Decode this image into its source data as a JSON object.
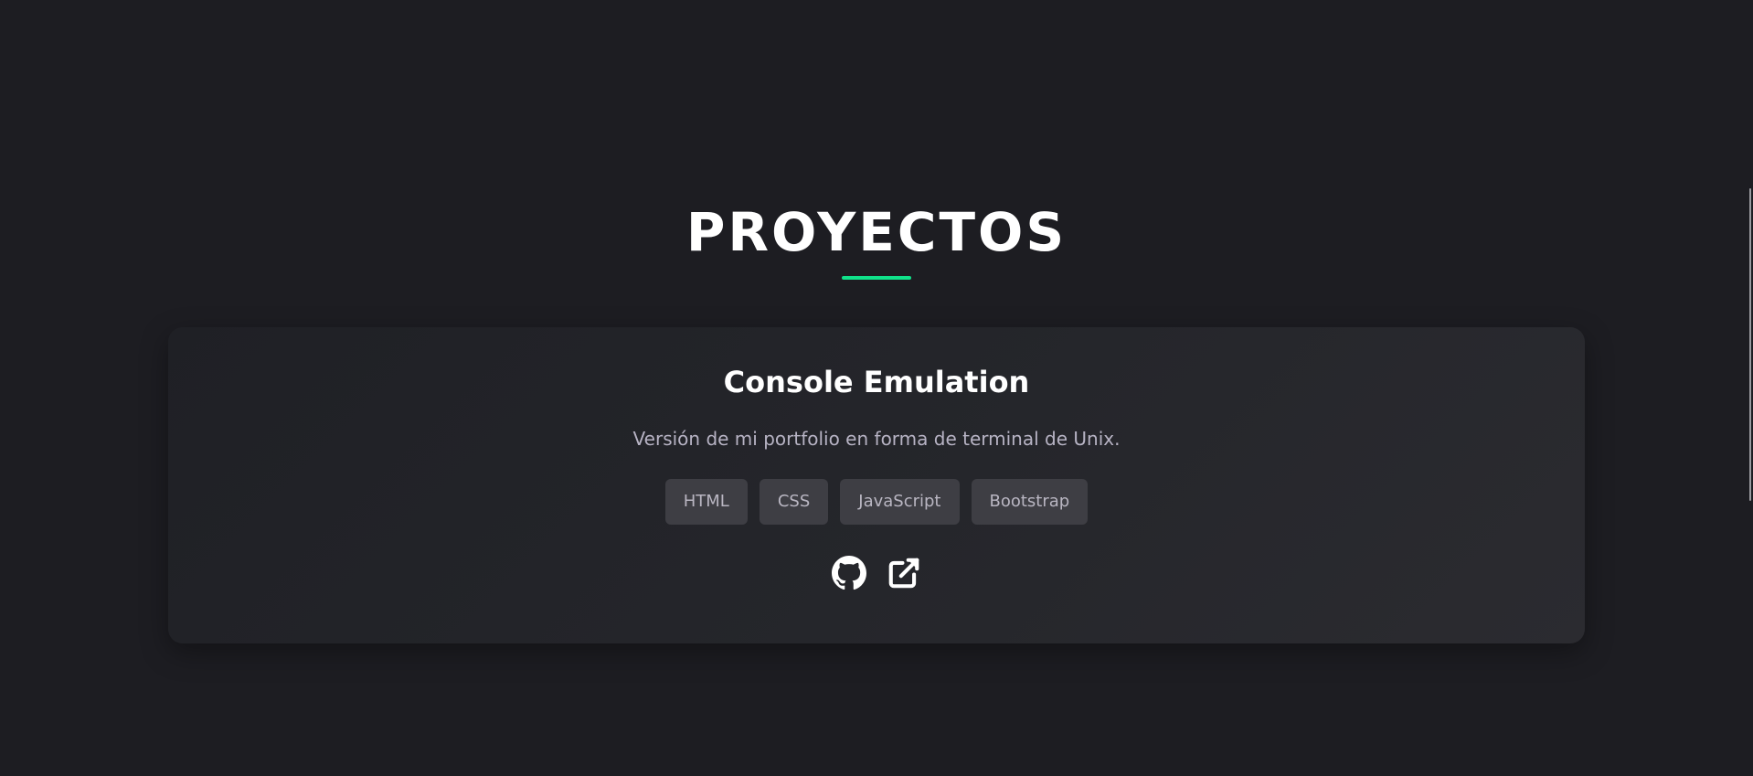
{
  "section": {
    "title": "PROYECTOS",
    "accent_color": "#10e28a"
  },
  "project": {
    "title": "Console Emulation",
    "description": "Versión de mi portfolio en forma de terminal de Unix.",
    "tags": [
      "HTML",
      "CSS",
      "JavaScript",
      "Bootstrap"
    ],
    "links": [
      {
        "icon": "github-icon"
      },
      {
        "icon": "external-link-icon"
      }
    ]
  }
}
